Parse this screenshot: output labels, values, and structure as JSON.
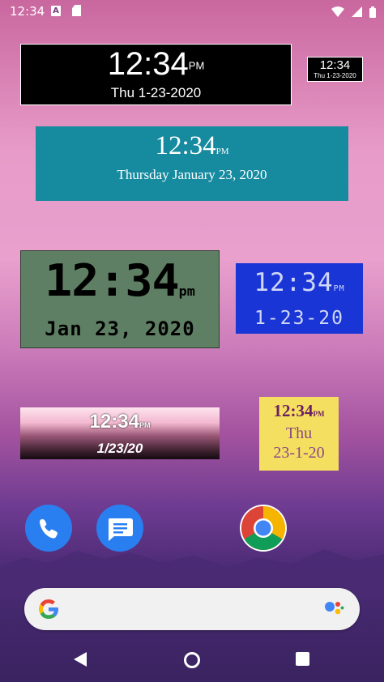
{
  "status_bar": {
    "time": "12:34",
    "notification_icons": [
      "a-icon",
      "sd-card-icon"
    ],
    "system_icons": [
      "wifi-icon",
      "signal-icon",
      "battery-icon"
    ]
  },
  "widgets": {
    "black_large": {
      "time": "12:34",
      "ampm": "PM",
      "date": "Thu 1-23-2020"
    },
    "black_small": {
      "time": "12:34",
      "date": "Thu 1-23-2020"
    },
    "teal": {
      "time": "12:34",
      "ampm": "PM",
      "date": "Thursday January 23, 2020"
    },
    "lcd_green": {
      "time": "12:34",
      "ampm": "pm",
      "date": "Jan 23, 2020"
    },
    "blue_digital": {
      "time": "12:34",
      "ampm": "PM",
      "date": "1-23-20"
    },
    "gradient": {
      "time": "12:34",
      "ampm": "PM",
      "date": "1/23/20"
    },
    "yellow": {
      "time": "12:34",
      "ampm": "PM",
      "day": "Thu",
      "date": "23-1-20"
    }
  },
  "dock": {
    "apps": [
      {
        "name": "Phone",
        "icon": "phone-icon"
      },
      {
        "name": "Messages",
        "icon": "messages-icon"
      },
      {
        "name": "Chrome",
        "icon": "chrome-icon"
      }
    ]
  },
  "search_bar": {
    "logo": "google-g-icon",
    "assistant": "google-assistant-icon"
  },
  "nav_bar": {
    "buttons": [
      "back-icon",
      "home-icon",
      "recents-icon"
    ]
  },
  "colors": {
    "teal_widget": "#168a9f",
    "lcd_widget": "#5e7f63",
    "blue_widget": "#1a35d6",
    "yellow_widget": "#f5df60",
    "dock_blue": "#2a7ff0"
  }
}
